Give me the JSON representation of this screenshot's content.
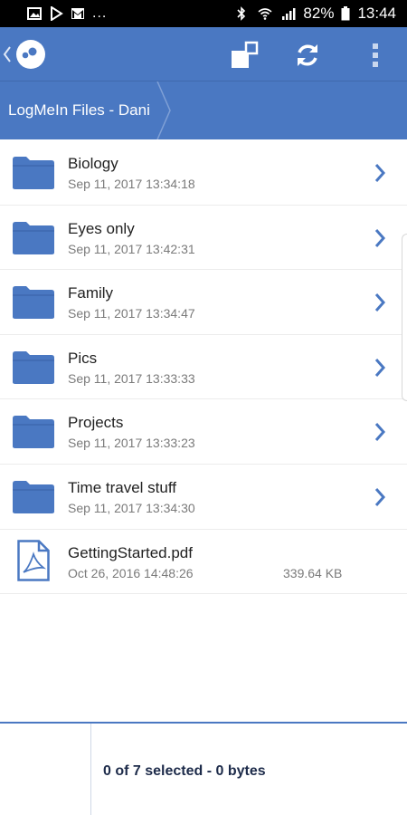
{
  "status_bar": {
    "left_icons": [
      "image-icon",
      "play-store-icon",
      "gmail-icon"
    ],
    "overflow": "...",
    "battery": "82%",
    "time": "13:44"
  },
  "app_bar": {
    "logo_icon": "logmein-logo-icon",
    "actions": [
      "window-icon",
      "refresh-icon",
      "more-vert-icon"
    ]
  },
  "breadcrumb": {
    "path": "LogMeIn Files - Dani"
  },
  "files": [
    {
      "name": "Biology",
      "date": "Sep 11, 2017 13:34:18",
      "type": "folder",
      "size": ""
    },
    {
      "name": "Eyes only",
      "date": "Sep 11, 2017 13:42:31",
      "type": "folder",
      "size": ""
    },
    {
      "name": "Family",
      "date": "Sep 11, 2017 13:34:47",
      "type": "folder",
      "size": ""
    },
    {
      "name": "Pics",
      "date": "Sep 11, 2017 13:33:33",
      "type": "folder",
      "size": ""
    },
    {
      "name": "Projects",
      "date": "Sep 11, 2017 13:33:23",
      "type": "folder",
      "size": ""
    },
    {
      "name": "Time travel stuff",
      "date": "Sep 11, 2017 13:34:30",
      "type": "folder",
      "size": ""
    },
    {
      "name": "GettingStarted.pdf",
      "date": "Oct 26, 2016 14:48:26",
      "type": "pdf",
      "size": "339.64 KB"
    }
  ],
  "footer": {
    "selection": "0 of 7 selected - 0 bytes"
  },
  "colors": {
    "primary": "#4a78c2",
    "folder": "#4a78c2",
    "status_bar": "#000000"
  }
}
